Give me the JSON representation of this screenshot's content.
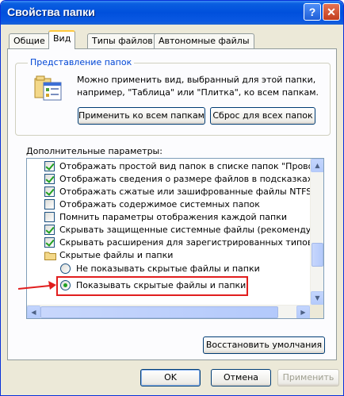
{
  "window": {
    "title": "Свойства папки",
    "help_label": "?",
    "close_label": "✕"
  },
  "tabs": [
    {
      "label": "Общие"
    },
    {
      "label": "Вид"
    },
    {
      "label": "Типы файлов"
    },
    {
      "label": "Автономные файлы"
    }
  ],
  "folder_views": {
    "label": "Представление папок",
    "description": "Можно применить вид, выбранный для этой папки, например, \"Таблица\" или \"Плитка\", ко всем папкам.",
    "apply_all_label": "Применить ко всем папкам",
    "reset_all_label": "Сброс для всех папок"
  },
  "advanced": {
    "label": "Дополнительные параметры:",
    "items": [
      {
        "text": "Отображать простой вид папок в списке папок \"Проводни",
        "type": "checkbox",
        "checked": true
      },
      {
        "text": "Отображать сведения о размере файлов в подсказках па",
        "type": "checkbox",
        "checked": true
      },
      {
        "text": "Отображать сжатые или зашифрованные файлы NTFS др",
        "type": "checkbox",
        "checked": true
      },
      {
        "text": "Отображать содержимое системных папок",
        "type": "checkbox",
        "checked": false
      },
      {
        "text": "Помнить параметры отображения каждой папки",
        "type": "checkbox",
        "checked": false
      },
      {
        "text": "Скрывать защищенные системные файлы (рекомендуетс",
        "type": "checkbox",
        "checked": true
      },
      {
        "text": "Скрывать расширения для зарегистрированных типов фа",
        "type": "checkbox",
        "checked": true
      },
      {
        "text": "Скрытые файлы и папки",
        "type": "folder"
      },
      {
        "text": "Не показывать скрытые файлы и папки",
        "type": "radio",
        "checked": false
      },
      {
        "text": "Показывать скрытые файлы и папки",
        "type": "radio",
        "checked": true
      }
    ]
  },
  "restore_defaults_label": "Восстановить умолчания",
  "footer": {
    "ok_label": "OK",
    "cancel_label": "Отмена",
    "apply_label": "Применить"
  }
}
